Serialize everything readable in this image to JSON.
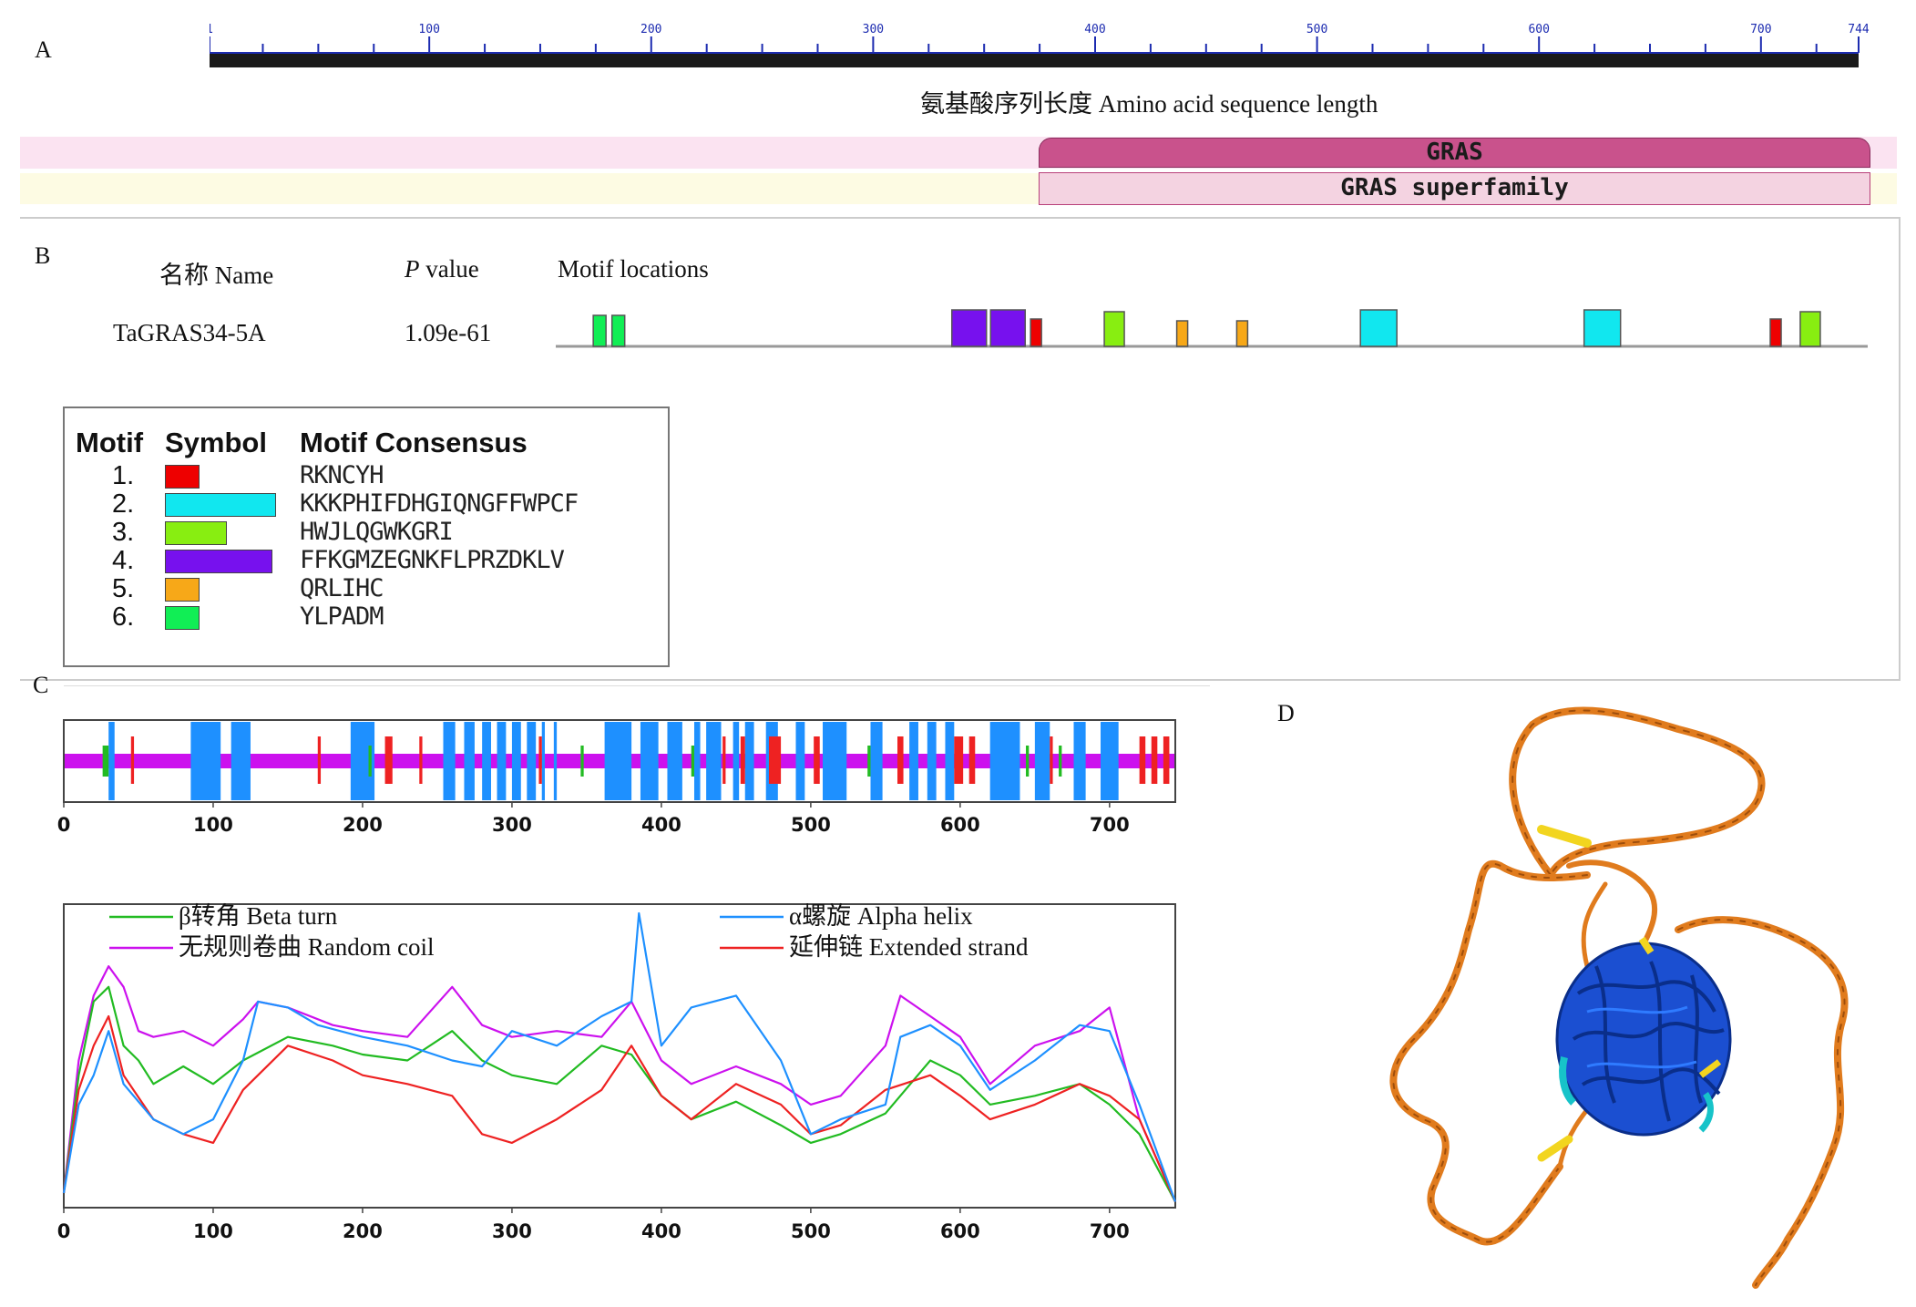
{
  "panel_labels": {
    "a": "A",
    "b": "B",
    "c": "C",
    "d": "D"
  },
  "panel_a": {
    "ruler_ticks": [
      "1",
      "100",
      "200",
      "300",
      "400",
      "500",
      "600",
      "700",
      "744"
    ],
    "axis_label": "氨基酸序列长度 Amino acid sequence length",
    "domain_label": "GRAS",
    "superfamily_label": "GRAS superfamily",
    "colors": {
      "gras": "#c9528c",
      "superfamily_fill": "#f4d3e1",
      "band_pink": "#fbe3f1",
      "band_yellow": "#fdfbe3"
    }
  },
  "panel_b": {
    "headers": {
      "name": "名称 Name",
      "p_italic": "P",
      "p_rest": " value",
      "locations": "Motif locations"
    },
    "row": {
      "name": "TaGRAS34-5A",
      "p_value": "1.09e-61"
    },
    "motif_sites": [
      {
        "motif": 6,
        "position": 30
      },
      {
        "motif": 6,
        "position": 45
      },
      {
        "motif": 4,
        "position": 317
      },
      {
        "motif": 4,
        "position": 348
      },
      {
        "motif": 1,
        "position": 380
      },
      {
        "motif": 3,
        "position": 439
      },
      {
        "motif": 5,
        "position": 497
      },
      {
        "motif": 5,
        "position": 545
      },
      {
        "motif": 2,
        "position": 644
      },
      {
        "motif": 2,
        "position": 823
      },
      {
        "motif": 1,
        "position": 972
      },
      {
        "motif": 3,
        "position": 996
      }
    ],
    "legend": {
      "headers": {
        "motif": "Motif",
        "symbol": "Symbol",
        "consensus": "Motif Consensus"
      },
      "motifs": [
        {
          "num": "1.",
          "consensus": "RKNCYH",
          "color": "#ee0000"
        },
        {
          "num": "2.",
          "consensus": "KKKPHIFDHGIQNGFFWPCF",
          "color": "#11e7ef"
        },
        {
          "num": "3.",
          "consensus": "HWJLQGWKGRI",
          "color": "#88ee11"
        },
        {
          "num": "4.",
          "consensus": "FFKGMZEGNKFLPRZDKLV",
          "color": "#7711ee"
        },
        {
          "num": "5.",
          "consensus": "QRLIHC",
          "color": "#f7a818"
        },
        {
          "num": "6.",
          "consensus": "YLPADM",
          "color": "#11ee55"
        }
      ]
    }
  },
  "panel_c": {
    "track_ticks": [
      "0",
      "100",
      "200",
      "300",
      "400",
      "500",
      "600",
      "700"
    ],
    "chart_ticks": [
      "0",
      "100",
      "200",
      "300",
      "400",
      "500",
      "600",
      "700"
    ],
    "legend": {
      "beta_turn": "β转角 Beta turn",
      "random_coil": "无规则卷曲 Random coil",
      "alpha_helix": "α螺旋 Alpha helix",
      "extended_strand": "延伸链 Extended strand"
    },
    "colors": {
      "alpha": "#1e90ff",
      "extended": "#ee2222",
      "turn": "#22bb22",
      "coil": "#cc11ee"
    }
  },
  "chart_data": {
    "type": "line",
    "xlabel": "",
    "ylabel": "",
    "xlim": [
      0,
      744
    ],
    "series": [
      {
        "name": "β转角 Beta turn",
        "x": [
          0,
          10,
          20,
          30,
          40,
          50,
          60,
          80,
          100,
          120,
          150,
          180,
          200,
          230,
          260,
          280,
          300,
          330,
          360,
          380,
          400,
          420,
          450,
          480,
          500,
          520,
          550,
          580,
          600,
          620,
          650,
          680,
          700,
          720,
          744
        ],
        "values": [
          0.05,
          0.45,
          0.7,
          0.75,
          0.55,
          0.5,
          0.42,
          0.48,
          0.42,
          0.5,
          0.58,
          0.55,
          0.52,
          0.5,
          0.6,
          0.5,
          0.45,
          0.42,
          0.55,
          0.52,
          0.38,
          0.3,
          0.36,
          0.28,
          0.22,
          0.25,
          0.32,
          0.5,
          0.45,
          0.35,
          0.38,
          0.42,
          0.35,
          0.25,
          0.02
        ]
      },
      {
        "name": "无规则卷曲 Random coil",
        "x": [
          0,
          10,
          20,
          30,
          40,
          50,
          60,
          80,
          100,
          120,
          130,
          150,
          180,
          200,
          230,
          260,
          280,
          300,
          330,
          360,
          380,
          400,
          420,
          450,
          480,
          500,
          520,
          550,
          560,
          580,
          600,
          620,
          650,
          680,
          700,
          720,
          744
        ],
        "values": [
          0.05,
          0.5,
          0.72,
          0.82,
          0.75,
          0.6,
          0.58,
          0.6,
          0.55,
          0.64,
          0.7,
          0.68,
          0.62,
          0.6,
          0.58,
          0.75,
          0.62,
          0.58,
          0.6,
          0.58,
          0.7,
          0.5,
          0.42,
          0.48,
          0.42,
          0.35,
          0.38,
          0.55,
          0.72,
          0.65,
          0.58,
          0.42,
          0.55,
          0.6,
          0.68,
          0.3,
          0.02
        ]
      },
      {
        "name": "α螺旋 Alpha helix",
        "x": [
          0,
          10,
          20,
          30,
          40,
          60,
          80,
          100,
          120,
          130,
          150,
          170,
          200,
          230,
          260,
          280,
          300,
          330,
          360,
          380,
          385,
          400,
          420,
          450,
          480,
          500,
          520,
          550,
          560,
          580,
          600,
          620,
          650,
          680,
          700,
          720,
          744
        ],
        "values": [
          0.05,
          0.35,
          0.45,
          0.6,
          0.42,
          0.3,
          0.25,
          0.3,
          0.5,
          0.7,
          0.68,
          0.62,
          0.58,
          0.55,
          0.5,
          0.48,
          0.6,
          0.55,
          0.65,
          0.7,
          1.0,
          0.55,
          0.68,
          0.72,
          0.5,
          0.25,
          0.3,
          0.35,
          0.58,
          0.62,
          0.55,
          0.4,
          0.5,
          0.62,
          0.6,
          0.35,
          0.02
        ]
      },
      {
        "name": "延伸链 Extended strand",
        "x": [
          0,
          10,
          20,
          30,
          40,
          60,
          80,
          100,
          120,
          150,
          180,
          200,
          230,
          260,
          280,
          300,
          330,
          360,
          380,
          400,
          420,
          450,
          480,
          500,
          520,
          550,
          580,
          600,
          620,
          650,
          680,
          700,
          720,
          744
        ],
        "values": [
          0.05,
          0.4,
          0.55,
          0.65,
          0.45,
          0.3,
          0.25,
          0.22,
          0.4,
          0.55,
          0.5,
          0.45,
          0.42,
          0.38,
          0.25,
          0.22,
          0.3,
          0.4,
          0.55,
          0.38,
          0.3,
          0.42,
          0.35,
          0.25,
          0.28,
          0.4,
          0.45,
          0.38,
          0.3,
          0.35,
          0.42,
          0.38,
          0.3,
          0.02
        ]
      }
    ]
  }
}
